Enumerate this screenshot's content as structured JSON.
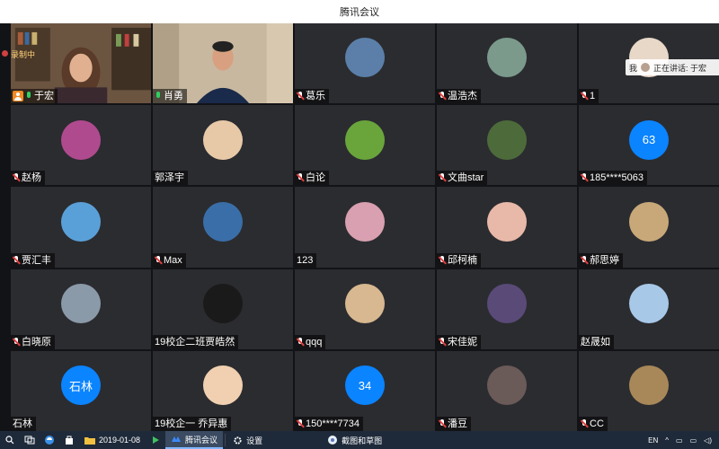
{
  "window": {
    "title": "腾讯会议"
  },
  "recording": {
    "label": "录制中"
  },
  "speaker": {
    "me_label": "我",
    "text": "正在讲话: 于宏"
  },
  "participants": [
    {
      "name": "于宏",
      "type": "video",
      "host": true,
      "mic": "on",
      "active": true
    },
    {
      "name": "肖勇",
      "type": "video",
      "mic": "on"
    },
    {
      "name": "葛乐",
      "type": "avatar",
      "mic": "muted",
      "avatar_color": "#5b7fa8"
    },
    {
      "name": "温浩杰",
      "type": "avatar",
      "mic": "muted",
      "avatar_color": "#7b9a8c"
    },
    {
      "name": "1",
      "type": "avatar",
      "mic": "muted",
      "avatar_color": "#e8d8c8"
    },
    {
      "name": "赵杨",
      "type": "avatar",
      "mic": "muted",
      "avatar_color": "#b04a8e"
    },
    {
      "name": "郭泽宇",
      "type": "avatar",
      "mic": "none",
      "avatar_color": "#e7c9a8"
    },
    {
      "name": "白论",
      "type": "avatar",
      "mic": "muted",
      "avatar_color": "#6aa53c"
    },
    {
      "name": "文曲star",
      "type": "avatar",
      "mic": "muted",
      "avatar_color": "#4d6b3a"
    },
    {
      "name": "185****5063",
      "type": "avatar",
      "mic": "muted",
      "avatar_color": "#0a84ff",
      "avatar_text": "63"
    },
    {
      "name": "贾汇丰",
      "type": "avatar",
      "mic": "muted",
      "avatar_color": "#5aa0d8"
    },
    {
      "name": "Max",
      "type": "avatar",
      "mic": "muted",
      "avatar_color": "#3a6ea8"
    },
    {
      "name": "123",
      "type": "avatar",
      "mic": "none",
      "avatar_color": "#d8a0b0"
    },
    {
      "name": "邱柯楠",
      "type": "avatar",
      "mic": "muted",
      "avatar_color": "#e8b8a8"
    },
    {
      "name": "郝思婷",
      "type": "avatar",
      "mic": "muted",
      "avatar_color": "#c8a878"
    },
    {
      "name": "白晓原",
      "type": "avatar",
      "mic": "muted",
      "avatar_color": "#8a9aa8"
    },
    {
      "name": "19校企二班贾皓然",
      "type": "avatar",
      "mic": "none",
      "avatar_color": "#1a1a1a"
    },
    {
      "name": "qqq",
      "type": "avatar",
      "mic": "muted",
      "avatar_color": "#d8b890"
    },
    {
      "name": "宋佳妮",
      "type": "avatar",
      "mic": "muted",
      "avatar_color": "#5a4a78"
    },
    {
      "name": "赵晟如",
      "type": "avatar",
      "mic": "none",
      "avatar_color": "#a8c8e8"
    },
    {
      "name": "石林",
      "type": "avatar",
      "mic": "none",
      "avatar_color": "#0a84ff",
      "avatar_text": "石林"
    },
    {
      "name": "19校企一 乔异惠",
      "type": "avatar",
      "mic": "none",
      "avatar_color": "#f0d0b0"
    },
    {
      "name": "150****7734",
      "type": "avatar",
      "mic": "muted",
      "avatar_color": "#0a84ff",
      "avatar_text": "34"
    },
    {
      "name": "潘豆",
      "type": "avatar",
      "mic": "muted",
      "avatar_color": "#6a5a58"
    },
    {
      "name": "CC",
      "type": "avatar",
      "mic": "muted",
      "avatar_color": "#a88858"
    }
  ],
  "taskbar": {
    "items": [
      {
        "label": "2019-01-08",
        "icon": "folder-icon"
      },
      {
        "label": "腾讯会议",
        "icon": "tencent-meeting-icon",
        "active": true
      },
      {
        "label": "设置",
        "icon": "gear-icon"
      },
      {
        "label": "截图和草图",
        "icon": "snip-icon"
      }
    ],
    "lang": "EN"
  }
}
